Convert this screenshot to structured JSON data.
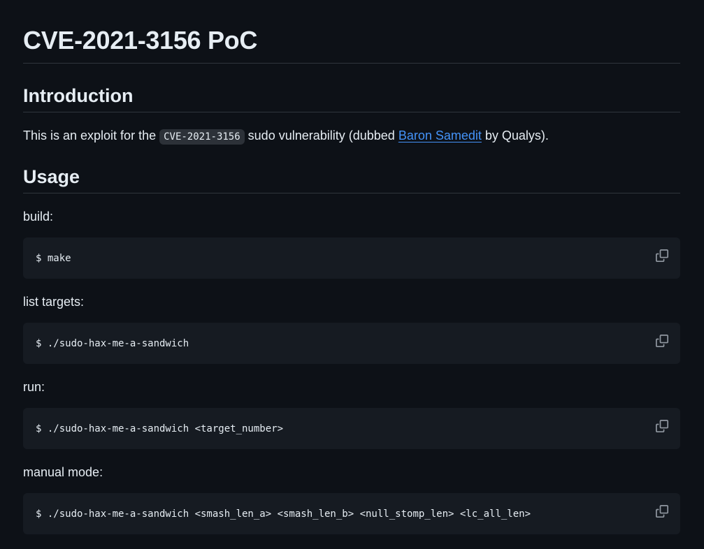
{
  "title": "CVE-2021-3156 PoC",
  "introduction": {
    "heading": "Introduction",
    "text_before": "This is an exploit for the ",
    "code": "CVE-2021-3156",
    "text_middle": " sudo vulnerability (dubbed ",
    "link_text": "Baron Samedit",
    "text_after": " by Qualys)."
  },
  "usage": {
    "heading": "Usage",
    "sections": [
      {
        "label": "build:",
        "command": "$ make"
      },
      {
        "label": "list targets:",
        "command": "$ ./sudo-hax-me-a-sandwich"
      },
      {
        "label": "run:",
        "command": "$ ./sudo-hax-me-a-sandwich <target_number>"
      },
      {
        "label": "manual mode:",
        "command": "$ ./sudo-hax-me-a-sandwich <smash_len_a> <smash_len_b> <null_stomp_len> <lc_all_len>"
      }
    ]
  },
  "icons": {
    "copy": "copy-icon"
  },
  "colors": {
    "background": "#0d1117",
    "code_bg": "#161b22",
    "text": "#e6edf3",
    "link": "#4493f8",
    "border": "#30363d"
  }
}
